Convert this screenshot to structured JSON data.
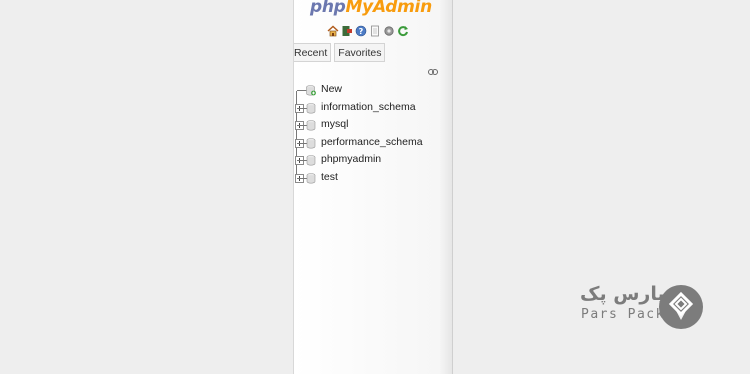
{
  "app": {
    "logo_php": "php",
    "logo_myadmin": "MyAdmin"
  },
  "quick_icons": [
    "home-icon",
    "exit-icon",
    "help-icon",
    "docs-icon",
    "settings-icon",
    "reload-icon"
  ],
  "tabs": [
    {
      "label": "Recent"
    },
    {
      "label": "Favorites"
    }
  ],
  "tree": {
    "new_label": "New",
    "databases": [
      {
        "name": "information_schema"
      },
      {
        "name": "mysql"
      },
      {
        "name": "performance_schema"
      },
      {
        "name": "phpmyadmin"
      },
      {
        "name": "test"
      }
    ]
  },
  "brand": {
    "name_fa": "پارس پک",
    "name_en": "Pars Pack",
    "color": "#7c7c7c"
  },
  "colors": {
    "logo_blue": "#6c78af",
    "logo_orange": "#f89c0e",
    "background": "#eeeeee"
  }
}
